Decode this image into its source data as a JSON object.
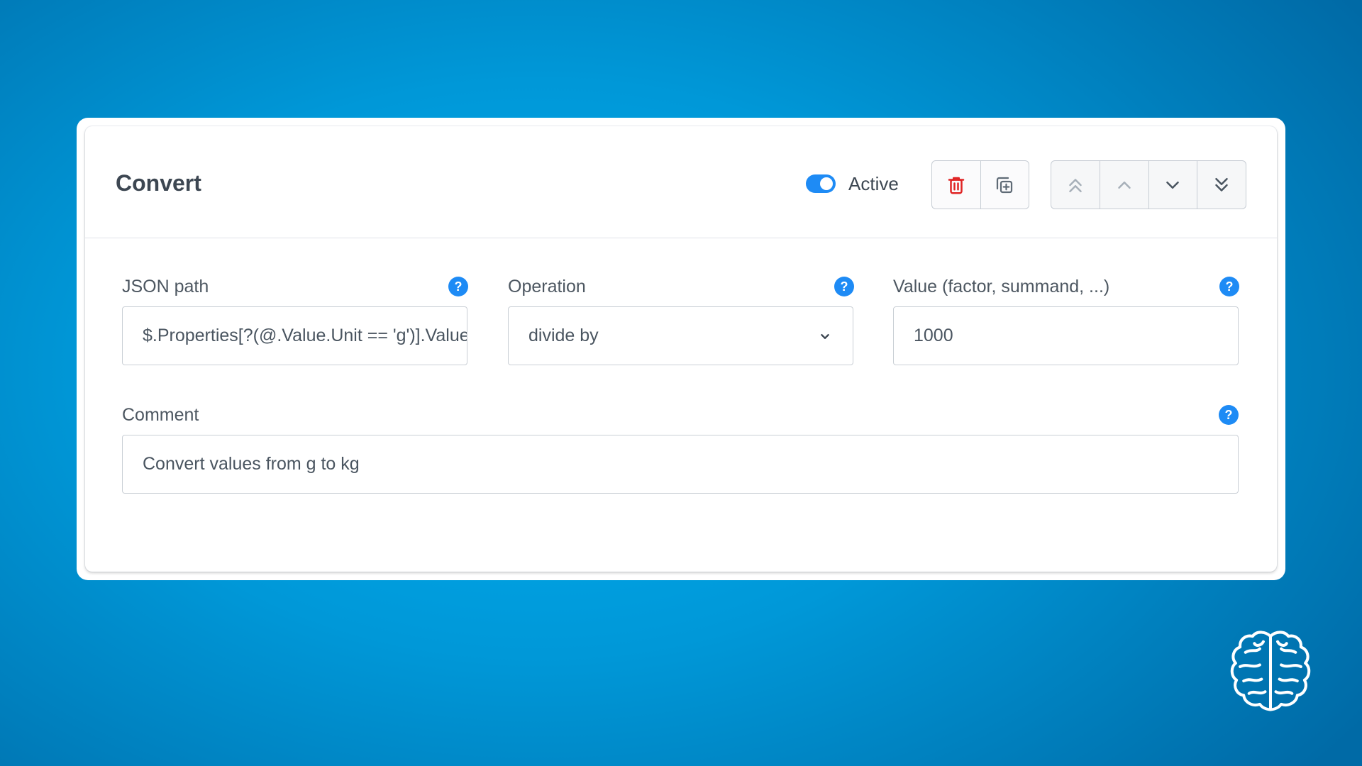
{
  "card": {
    "title": "Convert",
    "active_toggle": {
      "label": "Active",
      "checked": true
    },
    "action_buttons": [
      {
        "name": "delete",
        "icon": "trash-icon"
      },
      {
        "name": "duplicate",
        "icon": "copy-plus-icon"
      }
    ],
    "move_buttons": [
      {
        "name": "move-to-top",
        "icon": "double-chevron-up-icon"
      },
      {
        "name": "move-up",
        "icon": "chevron-up-icon"
      },
      {
        "name": "move-down",
        "icon": "chevron-down-icon"
      },
      {
        "name": "move-to-bottom",
        "icon": "double-chevron-down-icon"
      }
    ]
  },
  "fields": {
    "json_path": {
      "label": "JSON path",
      "value": "$.Properties[?(@.Value.Unit == 'g')].Value"
    },
    "operation": {
      "label": "Operation",
      "value": "divide by"
    },
    "value": {
      "label": "Value (factor, summand, ...)",
      "value": "1000"
    },
    "comment": {
      "label": "Comment",
      "value": "Convert values from g to kg"
    },
    "help_glyph": "?"
  },
  "colors": {
    "accent": "#1e8bf5",
    "delete_icon": "#e02424",
    "background_center": "#00aef0",
    "background_edge": "#006aa6"
  },
  "logo_icon": "brain-icon"
}
